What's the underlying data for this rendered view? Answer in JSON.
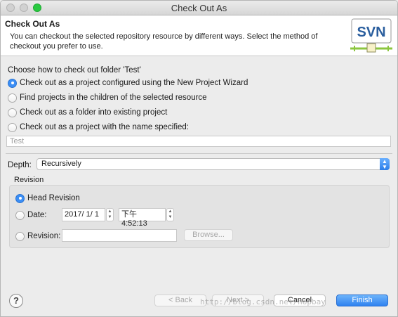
{
  "window": {
    "title": "Check Out As"
  },
  "header": {
    "title": "Check Out As",
    "description": "You can checkout the selected repository resource by different ways. Select the method of checkout you prefer to use.",
    "logo_text": "SVN"
  },
  "checkout": {
    "prompt": "Choose how to check out folder 'Test'",
    "options": [
      {
        "label": "Check out as a project configured using the New Project Wizard",
        "checked": true
      },
      {
        "label": "Find projects in the children of the selected resource",
        "checked": false
      },
      {
        "label": "Check out as a folder into existing project",
        "checked": false
      },
      {
        "label": "Check out as a project with the name specified:",
        "checked": false
      }
    ],
    "project_name_placeholder": "Test"
  },
  "depth": {
    "label": "Depth:",
    "value": "Recursively"
  },
  "revision": {
    "group_label": "Revision",
    "head_label": "Head Revision",
    "date_label": "Date:",
    "date_value": "2017/  1/  1",
    "time_value": "下午  4:52:13",
    "revision_label": "Revision:",
    "revision_value": "",
    "browse_label": "Browse..."
  },
  "footer": {
    "help_label": "?",
    "back_label": "< Back",
    "next_label": "Next >",
    "cancel_label": "Cancel",
    "finish_label": "Finish",
    "watermark": "http://blog.csdn.net/hopbay"
  },
  "colors": {
    "accent": "#3b8ef5",
    "svn_green": "#8cc63f",
    "svn_blue": "#2a5e9e"
  }
}
